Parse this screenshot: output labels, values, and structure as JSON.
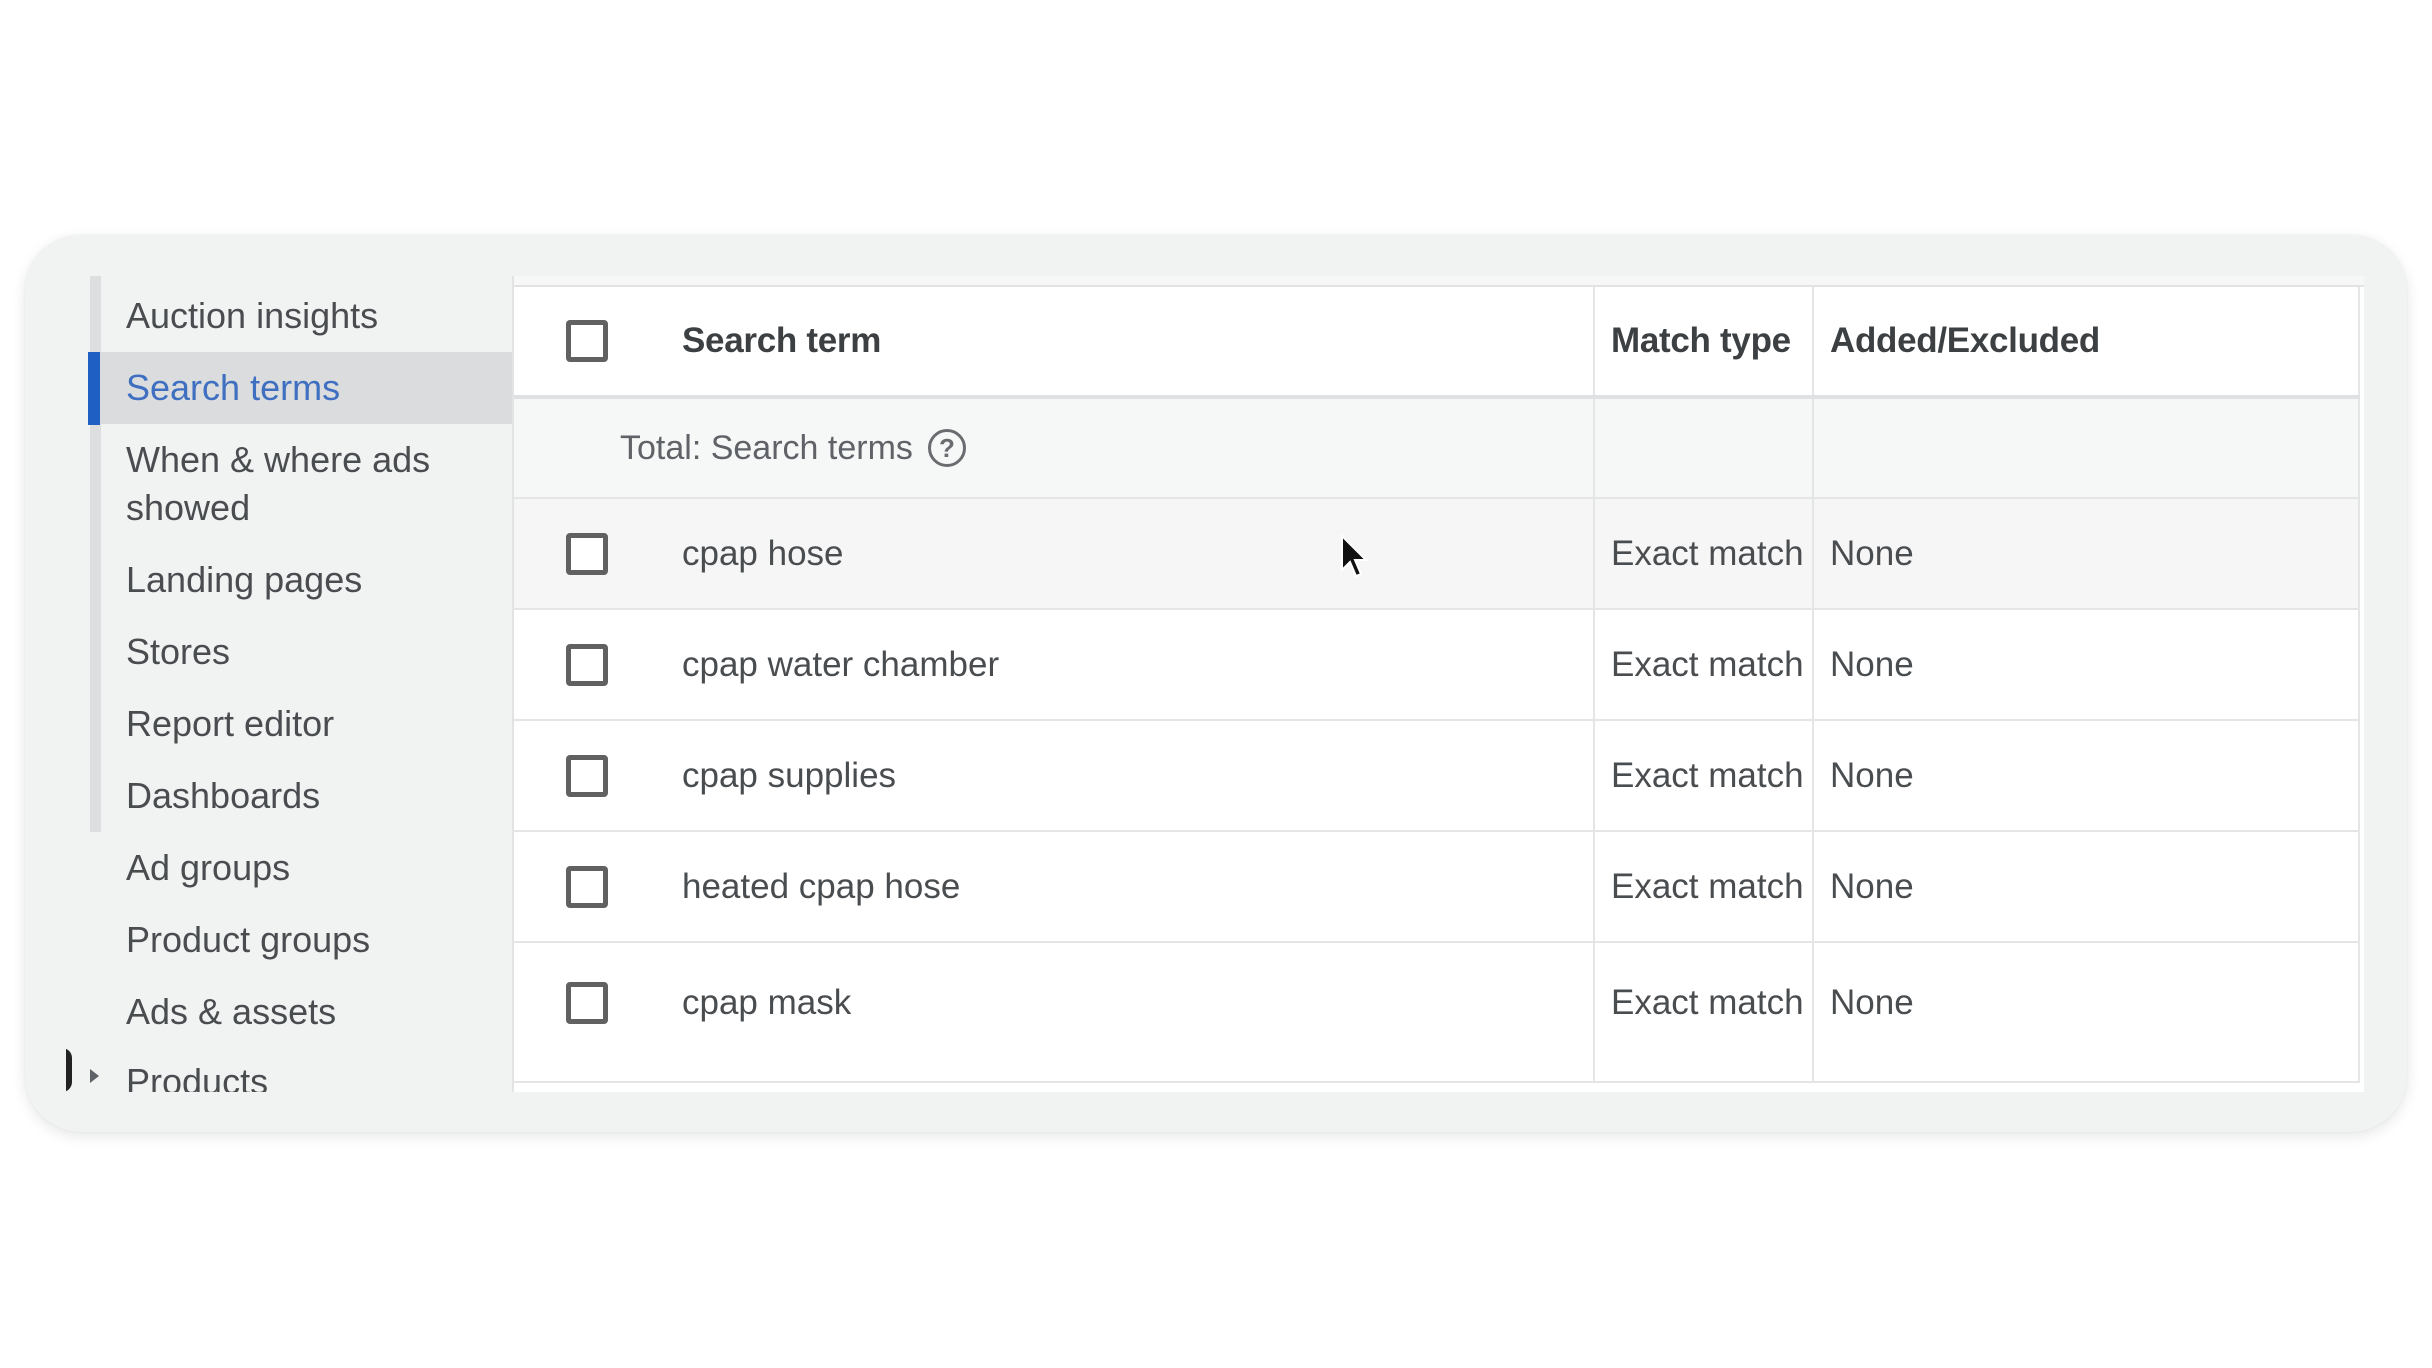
{
  "sidebar": {
    "items": [
      {
        "label": "Auction insights"
      },
      {
        "label": "Search terms",
        "active": true
      },
      {
        "label": "When & where ads showed"
      },
      {
        "label": "Landing pages"
      },
      {
        "label": "Stores"
      },
      {
        "label": "Report editor"
      },
      {
        "label": "Dashboards"
      },
      {
        "label": "Ad groups"
      },
      {
        "label": "Product groups"
      },
      {
        "label": "Ads & assets"
      },
      {
        "label": "Products",
        "expandable": true
      }
    ]
  },
  "table": {
    "columns": [
      "Search term",
      "Match type",
      "Added/Excluded"
    ],
    "total_label": "Total: Search terms",
    "help_icon": "help-circle-icon",
    "rows": [
      {
        "term": "cpap hose",
        "match_type": "Exact match",
        "added_excluded": "None"
      },
      {
        "term": "cpap water chamber",
        "match_type": "Exact match",
        "added_excluded": "None"
      },
      {
        "term": "cpap supplies",
        "match_type": "Exact match",
        "added_excluded": "None"
      },
      {
        "term": "heated cpap hose",
        "match_type": "Exact match",
        "added_excluded": "None"
      },
      {
        "term": "cpap mask",
        "match_type": "Exact match",
        "added_excluded": "None"
      }
    ]
  },
  "colors": {
    "accent": "#1f5fc4",
    "active_text": "#3f6fc0",
    "card_bg": "#f1f3f3"
  }
}
